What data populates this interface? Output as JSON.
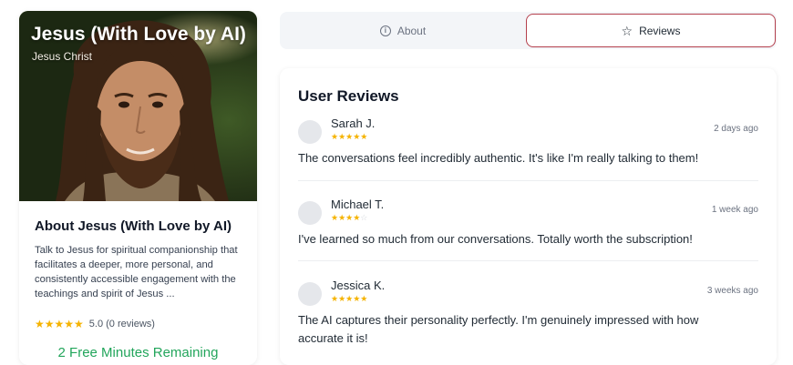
{
  "profile": {
    "title": "Jesus (With Love by AI)",
    "subtitle": "Jesus Christ",
    "about_heading": "About Jesus (With Love by AI)",
    "about_text": "Talk to Jesus for spiritual companionship that facilitates a deeper, more personal, and consistently accessible engagement with the teachings and spirit of Jesus ...",
    "rating_stars": "★★★★★",
    "rating_text": "5.0 (0 reviews)",
    "rating_value": 5.0,
    "free_minutes": "2 Free Minutes Remaining"
  },
  "tabs": {
    "about_label": "About",
    "reviews_label": "Reviews",
    "active": "Reviews"
  },
  "reviews": {
    "title": "User Reviews",
    "items": [
      {
        "name": "Sarah J.",
        "stars_filled": "★★★★★",
        "stars_empty": "",
        "rating": 5,
        "time": "2 days ago",
        "text": "The conversations feel incredibly authentic. It's like I'm really talking to them!"
      },
      {
        "name": "Michael T.",
        "stars_filled": "★★★★",
        "stars_empty": "☆",
        "rating": 4,
        "time": "1 week ago",
        "text": "I've learned so much from our conversations. Totally worth the subscription!"
      },
      {
        "name": "Jessica K.",
        "stars_filled": "★★★★★",
        "stars_empty": "",
        "rating": 5,
        "time": "3 weeks ago",
        "text": "The AI captures their personality perfectly. I'm genuinely impressed with how accurate it is!"
      }
    ]
  },
  "colors": {
    "accent_border": "#b4404d",
    "star": "#f5b301",
    "free_minutes": "#22a55b"
  }
}
